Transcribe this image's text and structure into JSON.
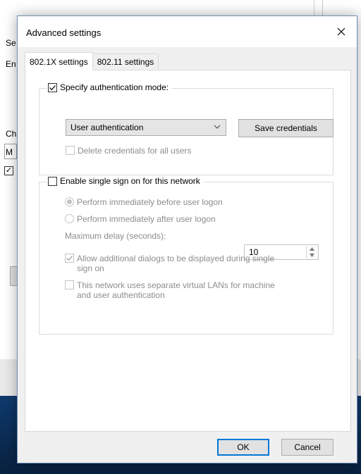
{
  "background": {
    "fragments": [
      "Se",
      "En",
      "Ch",
      "M"
    ]
  },
  "dialog": {
    "title": "Advanced settings",
    "close_icon": "close-icon",
    "tabs": [
      {
        "label": "802.1X settings",
        "active": true
      },
      {
        "label": "802.11 settings",
        "active": false
      }
    ],
    "auth_group": {
      "checkbox_label": "Specify authentication mode:",
      "checked": true,
      "mode_selected": "User authentication",
      "save_credentials_label": "Save credentials",
      "delete_credentials_label": "Delete credentials for all users",
      "delete_checked": false
    },
    "sso_group": {
      "checkbox_label": "Enable single sign on for this network",
      "checked": false,
      "radio_before_label": "Perform immediately before user logon",
      "radio_before_selected": true,
      "radio_after_label": "Perform immediately after user logon",
      "max_delay_label": "Maximum delay (seconds):",
      "max_delay_value": "10",
      "allow_dialogs_label_line1": "Allow additional dialogs to be displayed during single",
      "allow_dialogs_label_line2": "sign on",
      "allow_dialogs_checked": true,
      "vlan_label_line1": "This network uses separate virtual LANs for machine",
      "vlan_label_line2": "and user authentication",
      "vlan_checked": false
    },
    "ok_label": "OK",
    "cancel_label": "Cancel"
  }
}
